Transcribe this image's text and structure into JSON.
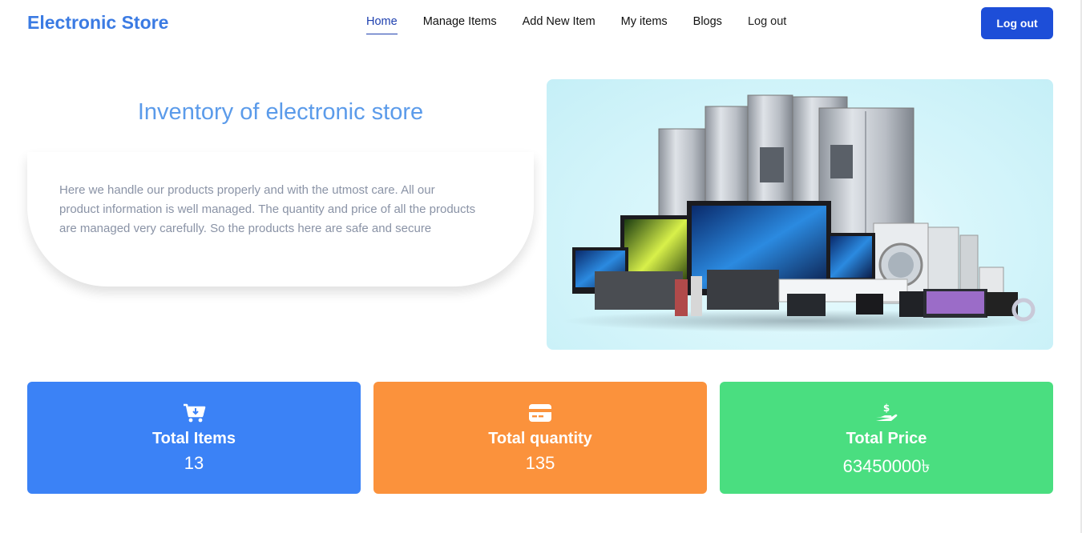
{
  "header": {
    "brand": "Electronic Store",
    "nav": [
      {
        "label": "Home",
        "active": true
      },
      {
        "label": "Manage Items",
        "active": false
      },
      {
        "label": "Add New Item",
        "active": false
      },
      {
        "label": "My items",
        "active": false
      },
      {
        "label": "Blogs",
        "active": false
      },
      {
        "label": "Log out",
        "active": false
      }
    ],
    "logout_button": "Log out"
  },
  "hero": {
    "title": "Inventory of electronic store",
    "description": "Here we handle our products properly and with the utmost care. All our product information is well managed. The quantity and price of all the products are managed very carefully. So the products here are safe and secure",
    "image_alt": "electronics-appliances-image"
  },
  "stats": [
    {
      "label": "Total Items",
      "value": "13",
      "icon": "cart-icon",
      "color": "#3b82f6"
    },
    {
      "label": "Total quantity",
      "value": "135",
      "icon": "credit-card-icon",
      "color": "#fb923c"
    },
    {
      "label": "Total Price",
      "value": "63450000৳",
      "icon": "hand-dollar-icon",
      "color": "#4ade80"
    }
  ],
  "colors": {
    "brand": "#3b7be3",
    "primary_button": "#1d4ed8",
    "active_nav": "#1e40af"
  }
}
